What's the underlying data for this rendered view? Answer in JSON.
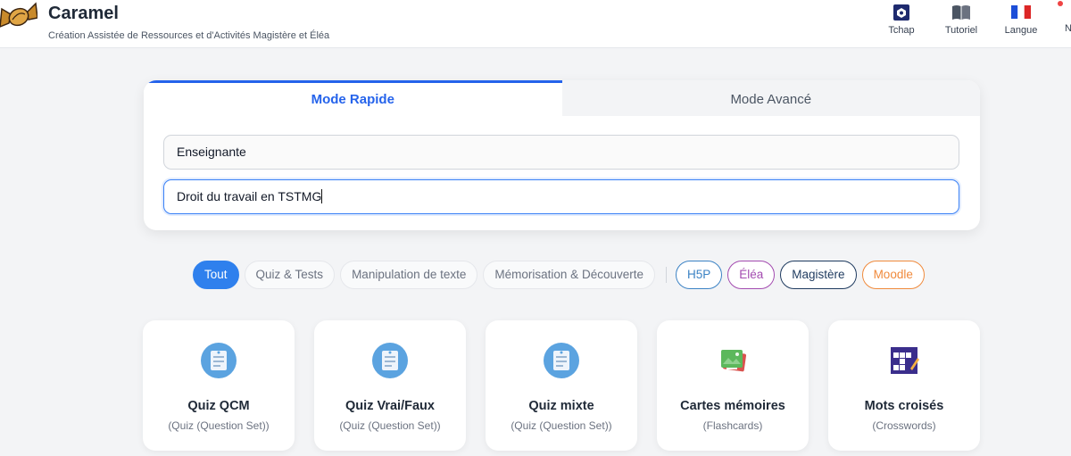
{
  "header": {
    "app_title": "Caramel",
    "subtitle": "Création Assistée de Ressources et d'Activités Magistère et Éléa",
    "nav": [
      {
        "label": "Tchap",
        "icon": "tchap-icon"
      },
      {
        "label": "Tutoriel",
        "icon": "book-icon"
      },
      {
        "label": "Langue",
        "icon": "french-flag-icon"
      }
    ],
    "nav_overflow": "N"
  },
  "modes": {
    "tabs": [
      {
        "label": "Mode Rapide",
        "active": true
      },
      {
        "label": "Mode Avancé",
        "active": false
      }
    ]
  },
  "form": {
    "role_value": "Enseignante",
    "topic_value": "Droit du travail en TSTMG"
  },
  "filters": {
    "categories": [
      "Tout",
      "Quiz & Tests",
      "Manipulation de texte",
      "Mémorisation & Découverte"
    ],
    "active_category": "Tout",
    "platforms": [
      {
        "label": "H5P",
        "color": "#3b82c4"
      },
      {
        "label": "Éléa",
        "color": "#a34bb0"
      },
      {
        "label": "Magistère",
        "color": "#1e3a5f"
      },
      {
        "label": "Moodle",
        "color": "#f08a3c"
      }
    ]
  },
  "activities": [
    {
      "title": "Quiz QCM",
      "subtitle": "(Quiz (Question Set))",
      "icon": "quiz-document-icon"
    },
    {
      "title": "Quiz Vrai/Faux",
      "subtitle": "(Quiz (Question Set))",
      "icon": "quiz-document-icon"
    },
    {
      "title": "Quiz mixte",
      "subtitle": "(Quiz (Question Set))",
      "icon": "quiz-document-icon"
    },
    {
      "title": "Cartes mémoires",
      "subtitle": "(Flashcards)",
      "icon": "flashcards-icon"
    },
    {
      "title": "Mots croisés",
      "subtitle": "(Crosswords)",
      "icon": "crossword-icon"
    }
  ],
  "colors": {
    "accent": "#2563eb",
    "active_chip": "#2f80ed"
  }
}
